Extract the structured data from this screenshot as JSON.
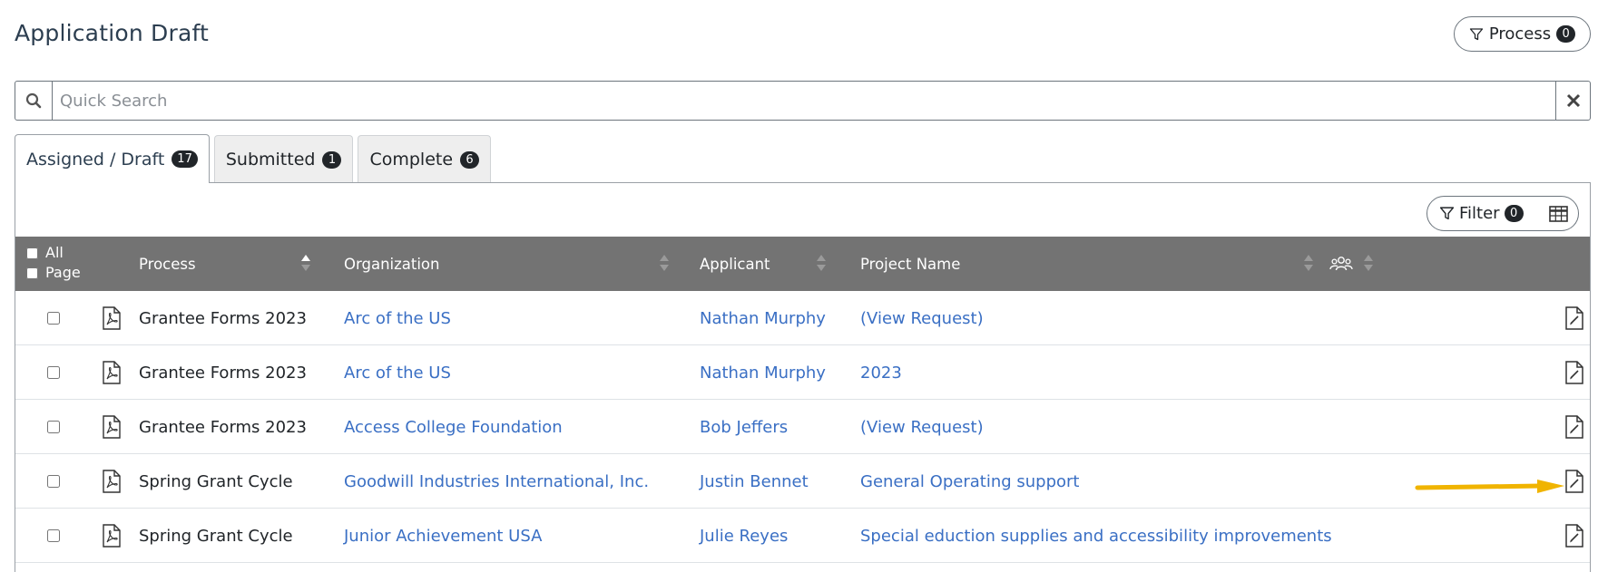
{
  "header": {
    "title": "Application Draft",
    "process_label": "Process",
    "process_count": "0"
  },
  "search": {
    "placeholder": "Quick Search",
    "value": ""
  },
  "tabs": [
    {
      "label": "Assigned / Draft",
      "count": "17",
      "active": true
    },
    {
      "label": "Submitted",
      "count": "1",
      "active": false
    },
    {
      "label": "Complete",
      "count": "6",
      "active": false
    }
  ],
  "toolbar": {
    "filter_label": "Filter",
    "filter_count": "0"
  },
  "table": {
    "select_all_label": "All",
    "select_page_label": "Page",
    "columns": {
      "process": "Process",
      "organization": "Organization",
      "applicant": "Applicant",
      "project": "Project Name"
    },
    "rows": [
      {
        "process": "Grantee Forms 2023",
        "organization": "Arc of the US",
        "applicant": "Nathan Murphy",
        "project": "(View Request)"
      },
      {
        "process": "Grantee Forms 2023",
        "organization": "Arc of the US",
        "applicant": "Nathan Murphy",
        "project": "2023"
      },
      {
        "process": "Grantee Forms 2023",
        "organization": "Access College Foundation",
        "applicant": "Bob Jeffers",
        "project": "(View Request)"
      },
      {
        "process": "Spring Grant Cycle",
        "organization": "Goodwill Industries International, Inc.",
        "applicant": "Justin Bennet",
        "project": "General Operating support"
      },
      {
        "process": "Spring Grant Cycle",
        "organization": "Junior Achievement USA",
        "applicant": "Julie Reyes",
        "project": "Special eduction supplies and accessibility improvements"
      }
    ]
  },
  "colors": {
    "header_bg": "#737373",
    "link": "#3a6fc4",
    "badge_bg": "#212529",
    "annotation_arrow": "#f0b400"
  },
  "icons": {
    "process": "filter-icon",
    "search": "search-icon",
    "clear": "close-icon",
    "filter": "filter-icon",
    "columns": "table-grid-icon",
    "team": "users-icon",
    "row_type": "pdf-file-icon",
    "row_action": "edit-document-icon"
  }
}
